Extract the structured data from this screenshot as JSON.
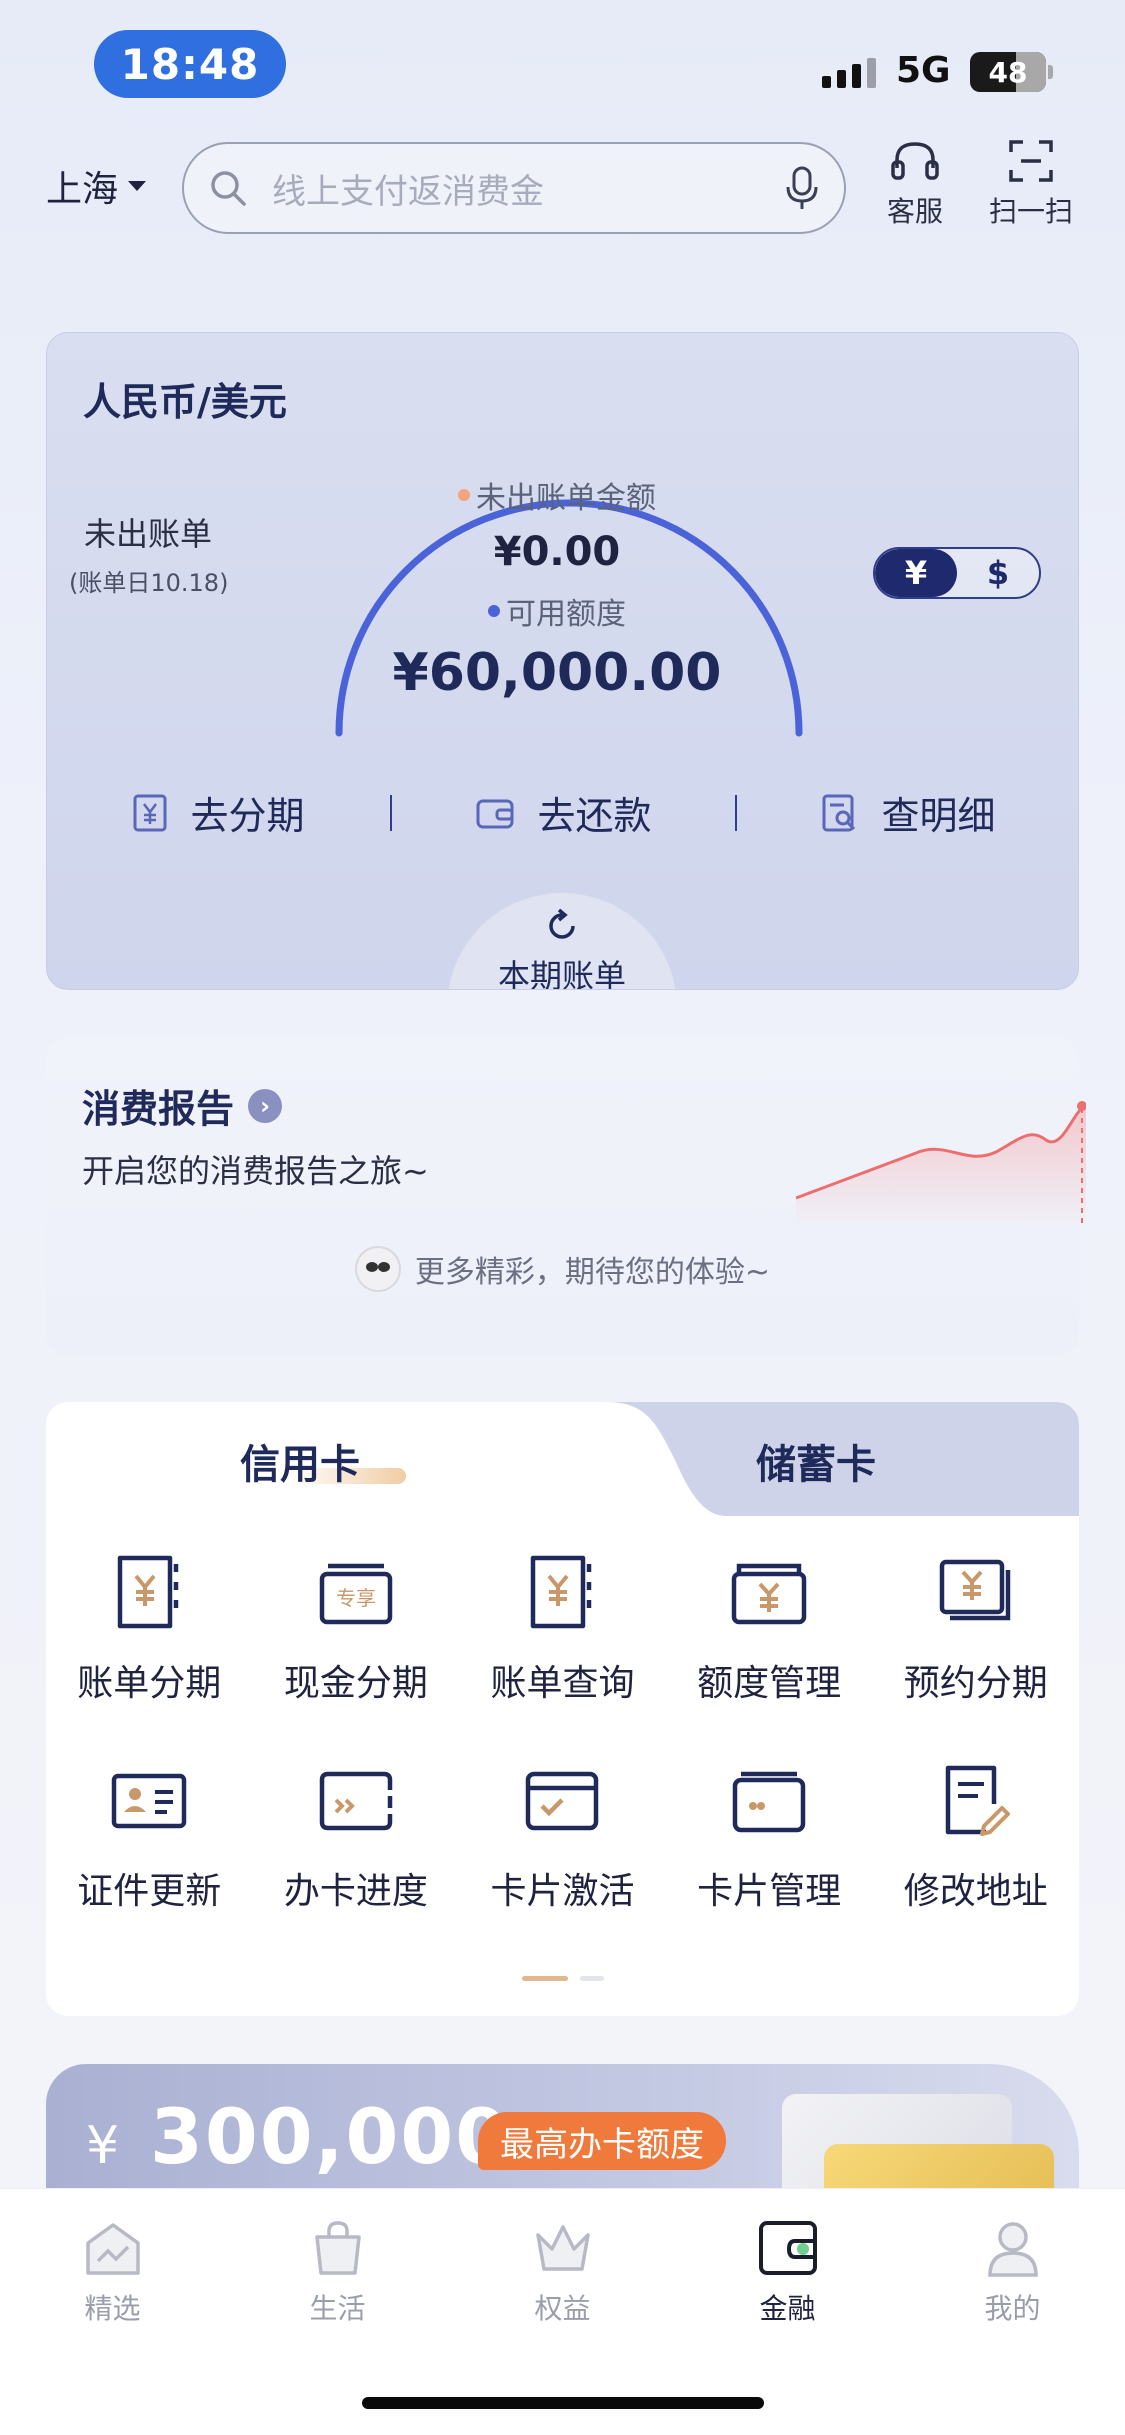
{
  "status_bar": {
    "time": "18:48",
    "network": "5G",
    "battery": "48"
  },
  "header": {
    "city": "上海",
    "search_placeholder": "线上支付返消费金",
    "service_label": "客服",
    "scan_label": "扫一扫"
  },
  "bill_card": {
    "currency_title": "人民币/美元",
    "unbilled_label": "未出账单",
    "bill_date": "(账单日10.18)",
    "unbilled_amount_label": "未出账单金额",
    "unbilled_amount": "¥0.00",
    "available_credit_label": "可用额度",
    "available_credit": "¥60,000.00",
    "available_ratio": 1.0,
    "currency_toggle": {
      "rmb": "¥",
      "usd": "$",
      "selected": "rmb"
    },
    "actions": [
      {
        "label": "去分期",
        "icon": "installment-yen-icon"
      },
      {
        "label": "去还款",
        "icon": "wallet-icon"
      },
      {
        "label": "查明细",
        "icon": "detail-search-icon"
      }
    ],
    "period_tab_label": "本期账单"
  },
  "report": {
    "title": "消费报告",
    "subtitle": "开启您的消费报告之旅~",
    "more_text": "更多精彩，期待您的体验~"
  },
  "card_services": {
    "tabs": [
      {
        "label": "信用卡",
        "active": true
      },
      {
        "label": "储蓄卡",
        "active": false
      }
    ],
    "items": [
      {
        "label": "账单分期",
        "icon": "bill-installment-icon"
      },
      {
        "label": "现金分期",
        "icon": "cash-installment-icon"
      },
      {
        "label": "账单查询",
        "icon": "bill-query-icon"
      },
      {
        "label": "额度管理",
        "icon": "credit-limit-icon"
      },
      {
        "label": "预约分期",
        "icon": "reserve-installment-icon"
      },
      {
        "label": "证件更新",
        "icon": "id-card-icon"
      },
      {
        "label": "办卡进度",
        "icon": "card-progress-icon"
      },
      {
        "label": "卡片激活",
        "icon": "card-activate-icon"
      },
      {
        "label": "卡片管理",
        "icon": "card-manage-icon"
      },
      {
        "label": "修改地址",
        "icon": "edit-address-icon"
      }
    ],
    "cash_badge_text": "专享"
  },
  "promo": {
    "currency": "¥",
    "amount": "300,000",
    "badge": "最高办卡额度"
  },
  "bottom_nav": [
    {
      "label": "精选",
      "icon": "featured-icon",
      "active": false
    },
    {
      "label": "生活",
      "icon": "life-bag-icon",
      "active": false
    },
    {
      "label": "权益",
      "icon": "crown-icon",
      "active": false
    },
    {
      "label": "金融",
      "icon": "finance-wallet-icon",
      "active": true
    },
    {
      "label": "我的",
      "icon": "profile-icon",
      "active": false
    }
  ],
  "colors": {
    "accent_blue": "#4b63d8",
    "navy": "#1f2a5a",
    "promo_orange": "#f07a3c",
    "gold": "#c9986a"
  }
}
